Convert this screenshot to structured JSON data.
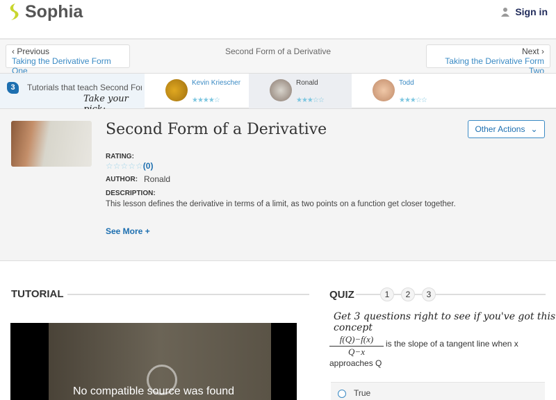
{
  "header": {
    "brand": "Sophia",
    "sign_in": "Sign in",
    "accent": "#c8d62e"
  },
  "nav": {
    "prev_label": "Previous",
    "prev_link": "Taking the Derivative Form One",
    "title": "Second Form of a Derivative",
    "next_label": "Next",
    "next_link": "Taking the Derivative Form Two"
  },
  "tutorials": {
    "count": "3",
    "title": "Tutorials that teach Second Form of a Derivative",
    "pick": "Take your pick:",
    "cards": [
      {
        "name": "Kevin Kriescher",
        "stars": "★★★★☆",
        "rating": 4
      },
      {
        "name": "Ronald",
        "stars": "★★★☆☆",
        "rating": 3
      },
      {
        "name": "Todd",
        "stars": "★★★☆☆",
        "rating": 3
      }
    ]
  },
  "lesson": {
    "title": "Second Form of a Derivative",
    "other_actions": "Other Actions",
    "rating_label": "RATING:",
    "rating_stars": "☆☆☆☆☆",
    "rating_count": "(0)",
    "author_label": "AUTHOR:",
    "author": "Ronald",
    "description_label": "DESCRIPTION:",
    "description": "This lesson defines the derivative in terms of a limit, as two points on a function get closer together.",
    "see_more": "See More +"
  },
  "tutorial": {
    "heading": "TUTORIAL",
    "video_message": "No compatible source was found"
  },
  "quiz": {
    "heading": "QUIZ",
    "steps": [
      "1",
      "2",
      "3"
    ],
    "intro": "Get 3 questions right to see if you've got this concept",
    "frac_num": "f(Q)−f(x)",
    "frac_den": "Q−x",
    "question": "is the slope of a tangent line when x",
    "question_end": "approaches Q",
    "option": "True"
  }
}
